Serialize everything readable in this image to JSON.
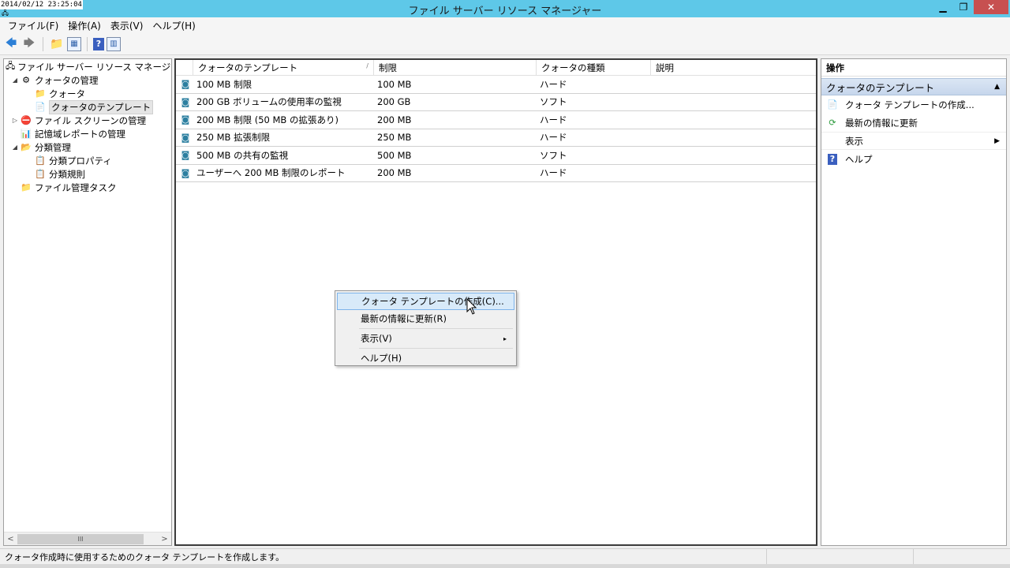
{
  "window": {
    "timestamp": "2014/02/12 23:25:04",
    "title": "ファイル サーバー リソース マネージャー",
    "controls": {
      "minimize": "▁",
      "restore": "❐",
      "close": "✕"
    }
  },
  "menubar": {
    "items": [
      "ファイル(F)",
      "操作(A)",
      "表示(V)",
      "ヘルプ(H)"
    ]
  },
  "toolbar": {
    "back": "🡄",
    "forward": "🡆",
    "help": "?"
  },
  "tree": {
    "nodes": [
      {
        "label": "ファイル サーバー リソース マネージャー (ロー",
        "exp": "",
        "icon": "🖧"
      },
      {
        "label": "クォータの管理",
        "exp": "◢",
        "icon": "⚙"
      },
      {
        "label": "クォータ",
        "exp": "",
        "icon": "📁"
      },
      {
        "label": "クォータのテンプレート",
        "exp": "",
        "icon": "📄"
      },
      {
        "label": "ファイル スクリーンの管理",
        "exp": "▷",
        "icon": "⛔"
      },
      {
        "label": "記憶域レポートの管理",
        "exp": "",
        "icon": "📊"
      },
      {
        "label": "分類管理",
        "exp": "◢",
        "icon": "📂"
      },
      {
        "label": "分類プロパティ",
        "exp": "",
        "icon": "📋"
      },
      {
        "label": "分類規則",
        "exp": "",
        "icon": "📋"
      },
      {
        "label": "ファイル管理タスク",
        "exp": "",
        "icon": "📁"
      }
    ],
    "scroll": {
      "left": "<",
      "right": ">",
      "thumb": "III"
    }
  },
  "list": {
    "columns": [
      "クォータのテンプレート",
      "制限",
      "クォータの種類",
      "説明"
    ],
    "sort_indicator": "/",
    "rows": [
      {
        "name": "100 MB 制限",
        "limit": "100 MB",
        "type": "ハード",
        "desc": ""
      },
      {
        "name": "200 GB ボリュームの使用率の監視",
        "limit": "200 GB",
        "type": "ソフト",
        "desc": ""
      },
      {
        "name": "200 MB 制限 (50 MB の拡張あり)",
        "limit": "200 MB",
        "type": "ハード",
        "desc": ""
      },
      {
        "name": "250 MB 拡張制限",
        "limit": "250 MB",
        "type": "ハード",
        "desc": ""
      },
      {
        "name": "500 MB の共有の監視",
        "limit": "500 MB",
        "type": "ソフト",
        "desc": ""
      },
      {
        "name": "ユーザーへ 200 MB 制限のレポート",
        "limit": "200 MB",
        "type": "ハード",
        "desc": ""
      }
    ]
  },
  "actions": {
    "title": "操作",
    "section": "クォータのテンプレート",
    "collapse": "▲",
    "items": [
      {
        "label": "クォータ テンプレートの作成...",
        "icon": "📄"
      },
      {
        "label": "最新の情報に更新",
        "icon": "⟳"
      },
      {
        "label": "表示",
        "icon": "",
        "submenu": "▶"
      },
      {
        "label": "ヘルプ",
        "icon": "?"
      }
    ]
  },
  "context_menu": {
    "items": [
      {
        "label": "クォータ テンプレートの作成(C)...",
        "highlighted": true
      },
      {
        "label": "最新の情報に更新(R)",
        "highlighted": false
      },
      {
        "label": "表示(V)",
        "highlighted": false,
        "submenu": "▸"
      },
      {
        "label": "ヘルプ(H)",
        "highlighted": false
      }
    ]
  },
  "statusbar": {
    "text": "クォータ作成時に使用するためのクォータ テンプレートを作成します。"
  }
}
